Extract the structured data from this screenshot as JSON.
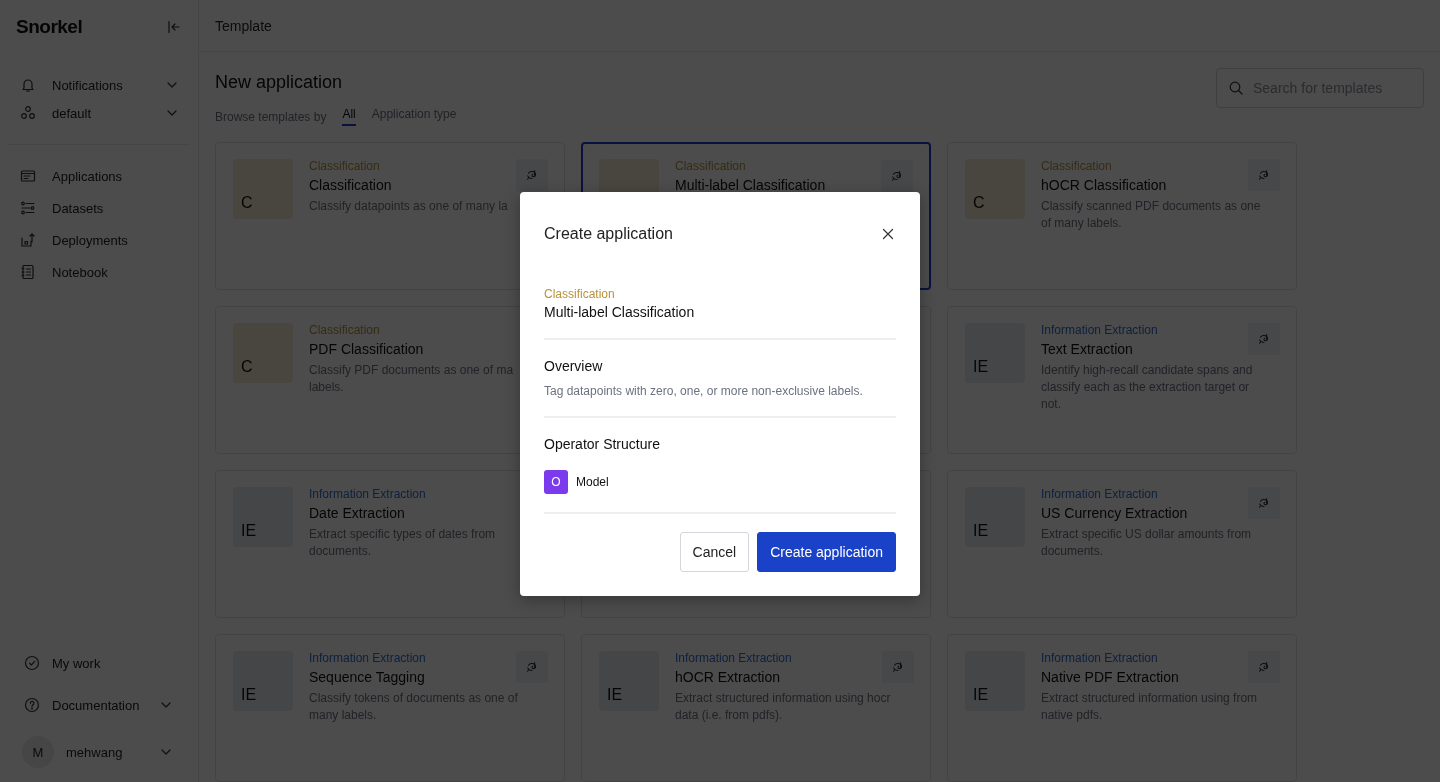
{
  "sidebar": {
    "logo": "Snorkel",
    "top_items": [
      {
        "label": "Notifications"
      },
      {
        "label": "default"
      }
    ],
    "nav_items": [
      {
        "label": "Applications"
      },
      {
        "label": "Datasets"
      },
      {
        "label": "Deployments"
      },
      {
        "label": "Notebook"
      }
    ],
    "bottom_items": [
      {
        "label": "My work",
        "chevron": false
      },
      {
        "label": "Documentation",
        "chevron": true
      }
    ],
    "user": {
      "initial": "M",
      "name": "mehwang"
    }
  },
  "header": {
    "title": "Template"
  },
  "page": {
    "title": "New application",
    "browse_label": "Browse templates by",
    "tabs": [
      {
        "label": "All",
        "selected": true
      },
      {
        "label": "Application type",
        "selected": false
      }
    ],
    "search": {
      "placeholder": "Search for templates"
    }
  },
  "cards": [
    {
      "kind": "classification",
      "thumb": "C",
      "category": "Classification",
      "title": "Classification",
      "description": [
        "Classify datapoints as one of many la"
      ],
      "selected": false,
      "has_icon": true
    },
    {
      "kind": "classification",
      "category": "Classification",
      "title": "Multi-label Classification",
      "selected": true,
      "has_icon": true
    },
    {
      "kind": "classification",
      "thumb": "C",
      "category": "Classification",
      "title": "hOCR Classification",
      "description": [
        "Classify scanned PDF documents as one",
        "of many labels."
      ],
      "selected": false,
      "has_icon": true
    },
    {
      "kind": "classification",
      "thumb": "C",
      "category": "Classification",
      "title": "PDF Classification",
      "description": [
        "Classify PDF documents as one of ma",
        "labels."
      ],
      "selected": false,
      "has_icon": false
    },
    {
      "selected": false
    },
    {
      "kind": "extraction",
      "thumb": "IE",
      "category": "Information Extraction",
      "title": "Text Extraction",
      "description": [
        "Identify high-recall candidate spans and",
        "classify each as the extraction target or",
        "not."
      ],
      "selected": false,
      "has_icon": true
    },
    {
      "kind": "extraction",
      "thumb": "IE",
      "category": "Information Extraction",
      "title": "Date Extraction",
      "description": [
        "Extract specific types of dates from",
        "documents."
      ],
      "selected": false,
      "has_icon": false
    },
    {
      "selected": false
    },
    {
      "kind": "extraction",
      "thumb": "IE",
      "category": "Information Extraction",
      "title": "US Currency Extraction",
      "description": [
        "Extract specific US dollar amounts from",
        "documents."
      ],
      "selected": false,
      "has_icon": true
    },
    {
      "kind": "extraction",
      "thumb": "IE",
      "category": "Information Extraction",
      "title": "Sequence Tagging",
      "description": [
        "Classify tokens of documents as one of",
        "many labels."
      ],
      "selected": false,
      "has_icon": true
    },
    {
      "kind": "extraction",
      "thumb": "IE",
      "category": "Information Extraction",
      "title": "hOCR Extraction",
      "description": [
        "Extract structured information using hocr",
        "data (i.e. from pdfs)."
      ],
      "selected": false,
      "has_icon": true
    },
    {
      "kind": "extraction",
      "thumb": "IE",
      "category": "Information Extraction",
      "title": "Native PDF Extraction",
      "description": [
        "Extract structured information using from",
        "native pdfs."
      ],
      "selected": false,
      "has_icon": true
    }
  ],
  "modal": {
    "title": "Create application",
    "kind": "classification",
    "category": "Classification",
    "name": "Multi-label Classification",
    "overview_heading": "Overview",
    "overview": "Tag datapoints with zero, one, or more non-exclusive labels.",
    "structure_heading": "Operator Structure",
    "operators": [
      {
        "initial": "O",
        "label": "Model",
        "color": "#7c3aed"
      }
    ],
    "buttons": [
      {
        "label": "Cancel",
        "kind": "secondary"
      },
      {
        "label": "Create application",
        "kind": "primary"
      }
    ]
  }
}
